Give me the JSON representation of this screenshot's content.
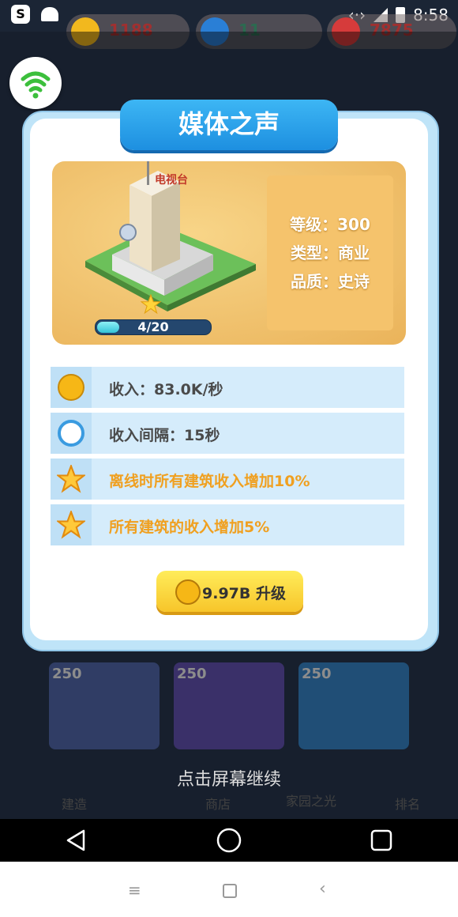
{
  "status_bar": {
    "time": "8:58"
  },
  "hud": {
    "coins": "1188",
    "gems": "11",
    "hearts": "7875"
  },
  "panel": {
    "title": "媒体之声",
    "building_sign": "电视台",
    "info": [
      "等级：300",
      "类型：商业",
      "品质：史诗"
    ],
    "progress_text": "4/20",
    "progress_fraction": 0.2,
    "stats": [
      {
        "icon": "coin-icon",
        "text": "收入：83.0K/秒",
        "color": "#4a4a4a"
      },
      {
        "icon": "clock-icon",
        "text": "收入间隔：15秒",
        "color": "#4a4a4a"
      },
      {
        "icon": "star-icon",
        "text": "离线时所有建筑收入增加10%",
        "color": "#f0a020"
      },
      {
        "icon": "star-icon",
        "text": "所有建筑的收入增加5%",
        "color": "#f0a020"
      }
    ],
    "upgrade_button": {
      "cost": "9.97B",
      "label": "升级"
    }
  },
  "tiles": [
    "250",
    "250",
    "250"
  ],
  "tap_continue": "点击屏幕继续",
  "bottom_nav": [
    "建造",
    "商店",
    "家园之光",
    "排名"
  ]
}
